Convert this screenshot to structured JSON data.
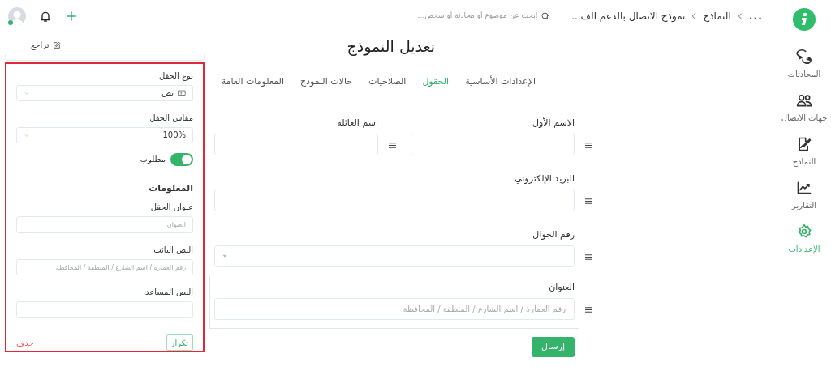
{
  "sidebar": {
    "items": [
      {
        "label": "المحادثات",
        "selected": false
      },
      {
        "label": "جهات الاتصال",
        "selected": false
      },
      {
        "label": "النماذج",
        "selected": false
      },
      {
        "label": "التقارير",
        "selected": false
      },
      {
        "label": "الإعدادات",
        "selected": true
      }
    ]
  },
  "topbar": {
    "breadcrumb": [
      {
        "label": "...",
        "kind": "more"
      },
      {
        "label": "النماذج",
        "kind": "link"
      },
      {
        "label": "نموذج الاتصال بالدعم الف...",
        "kind": "current"
      }
    ],
    "search": {
      "placeholder": "ابحث عن موضوع أو محادثة أو شخص..."
    },
    "user": {
      "online": true
    }
  },
  "editor": {
    "title": "تعديل النموذج",
    "tabs": [
      {
        "label": "الإعدادات الأساسية",
        "selected": false
      },
      {
        "label": "الحقول",
        "selected": true
      },
      {
        "label": "الصلاحيات",
        "selected": false
      },
      {
        "label": "حالات النموذج",
        "selected": false
      },
      {
        "label": "المعلومات العامة",
        "selected": false
      }
    ],
    "rows": [
      {
        "fields": [
          {
            "label": "الاسم الأول",
            "kind": "text",
            "selected": false
          },
          {
            "label": "اسم العائلة",
            "kind": "text",
            "selected": false
          }
        ]
      },
      {
        "fields": [
          {
            "label": "البريد الإلكتروني",
            "kind": "text",
            "selected": false
          }
        ]
      },
      {
        "fields": [
          {
            "label": "رقم الجوال",
            "kind": "phone",
            "selected": false
          }
        ]
      },
      {
        "fields": [
          {
            "label": "العنوان",
            "kind": "text",
            "placeholder": "رقم العمارة / اسم الشارع / المنطقة / المحافظة",
            "selected": true
          }
        ]
      }
    ],
    "submit": "إرسال"
  },
  "panel": {
    "undo": "تراجع",
    "field_type": {
      "label": "نوع الحقل",
      "value": "نص"
    },
    "field_size": {
      "label": "مقاس الحقل",
      "value": "100%"
    },
    "required": {
      "label": "مطلوب",
      "on": true
    },
    "info_heading": "المعلومات",
    "inputs": [
      {
        "label": "عنوان الحقل",
        "placeholder": "العنوان"
      },
      {
        "label": "النص النائب",
        "placeholder": "رقم العمارة / اسم الشارع / المنطقة / المحافظة"
      },
      {
        "label": "النص المساعد"
      }
    ],
    "duplicate": "تكرار",
    "delete": "حذف"
  }
}
